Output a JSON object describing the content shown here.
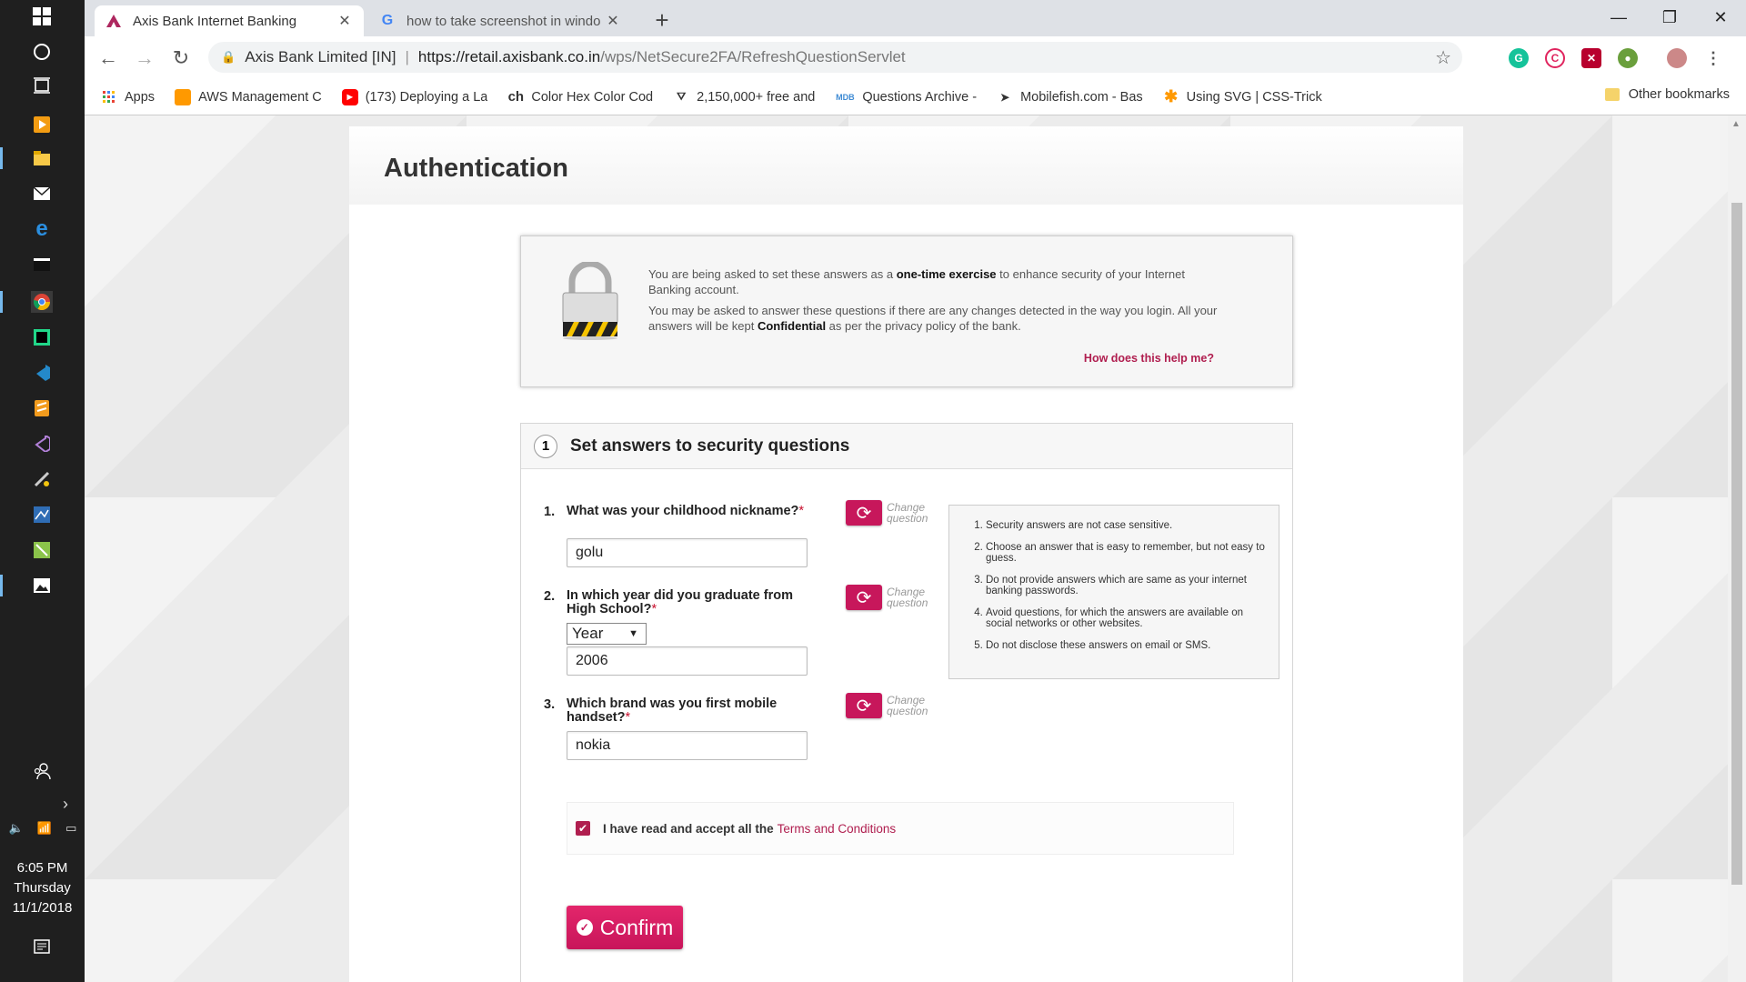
{
  "taskbar": {
    "time": "6:05 PM",
    "day": "Thursday",
    "date": "11/1/2018"
  },
  "browser": {
    "tabs": [
      {
        "title": "Axis Bank Internet Banking",
        "active": true
      },
      {
        "title": "how to take screenshot in windo",
        "active": false
      }
    ],
    "address": {
      "org": "Axis Bank Limited [IN]",
      "host": "https://retail.axisbank.co.in",
      "path": "/wps/NetSecure2FA/RefreshQuestionServlet"
    },
    "bookmarks": [
      {
        "label": "Apps",
        "icon": "apps-grid-icon"
      },
      {
        "label": "AWS Management C",
        "icon": "aws-icon"
      },
      {
        "label": "(173) Deploying a La",
        "icon": "youtube-icon"
      },
      {
        "label": "Color Hex Color Cod",
        "icon": "colorhex-icon"
      },
      {
        "label": "2,150,000+ free and",
        "icon": "freepik-icon"
      },
      {
        "label": "Questions Archive -",
        "icon": "mdb-icon"
      },
      {
        "label": "Mobilefish.com - Bas",
        "icon": "mobilefish-icon"
      },
      {
        "label": "Using SVG | CSS-Trick",
        "icon": "css-tricks-icon"
      }
    ],
    "bookmarks_more": "»",
    "other_bookmarks": "Other bookmarks"
  },
  "page": {
    "heading": "Authentication",
    "info": {
      "line1_a": "You are being asked to set these answers as a ",
      "line1_b": "one-time exercise",
      "line1_c": " to enhance security of your Internet Banking account.",
      "line2_a": "You may be asked to answer these questions if there are any changes detected in the way you login. All your answers will be kept ",
      "line2_b": "Confidential",
      "line2_c": " as per the privacy policy of the bank.",
      "help_link": "How does this help me?"
    },
    "section": {
      "step": "1",
      "title": "Set answers to security questions"
    },
    "questions": [
      {
        "num": "1.",
        "label": "What was your childhood nickname?",
        "answer": "golu"
      },
      {
        "num": "2.",
        "label": "In which year did you graduate from High School?",
        "select": "Year",
        "answer": "2006"
      },
      {
        "num": "3.",
        "label": "Which brand was you first mobile handset?",
        "answer": "nokia"
      }
    ],
    "required_mark": "*",
    "change_label_1": "Change",
    "change_label_2": "question",
    "tips": [
      "Security answers are not case sensitive.",
      "Choose an answer that is easy to remember, but not easy to guess.",
      "Do not provide answers which are same as your internet banking passwords.",
      "Avoid questions, for which the answers are available on social networks or other websites.",
      "Do not disclose these answers on email or SMS."
    ],
    "terms_text": "I have read and accept all the",
    "terms_link": "Terms and Conditions",
    "terms_checked": true,
    "confirm_label": "Confirm"
  },
  "colors": {
    "brand": "#c8155a",
    "link": "#b01e4f"
  }
}
